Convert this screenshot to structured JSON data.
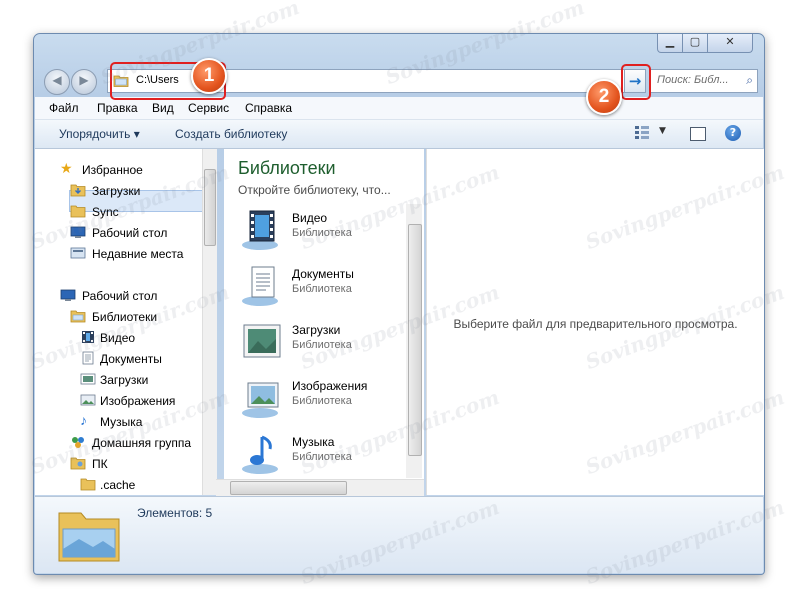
{
  "window": {
    "caption_buttons": {
      "minimize_icon": "minimize-icon",
      "maximize_icon": "maximize-icon",
      "close_icon": "close-icon"
    }
  },
  "navigation": {
    "back_icon": "back-arrow-icon",
    "forward_icon": "forward-arrow-icon"
  },
  "address_bar": {
    "path": "C:\\Users",
    "go_icon": "arrow-right-icon"
  },
  "search": {
    "placeholder": "Поиск: Библ..."
  },
  "annotations": {
    "marker1": "1",
    "marker2": "2",
    "highlight_color": "#e02020"
  },
  "menu": {
    "file": "Файл",
    "edit": "Правка",
    "view": "Вид",
    "service": "Сервис",
    "help": "Справка"
  },
  "toolbar": {
    "organize": "Упорядочить ▾",
    "create_library": "Создать библиотеку",
    "help": "?"
  },
  "nav_pane": {
    "favorites": "Избранное",
    "downloads": "Загрузки",
    "sync": "Sync",
    "desktop": "Рабочий стол",
    "recent": "Недавние места",
    "desktop_root": "Рабочий стол",
    "libraries": "Библиотеки",
    "video": "Видео",
    "documents": "Документы",
    "downloads2": "Загрузки",
    "images": "Изображения",
    "music": "Музыка",
    "homegroup": "Домашняя группа",
    "pc": "ПК",
    "cache": ".cache"
  },
  "libraries_pane": {
    "title": "Библиотеки",
    "subtitle": "Откройте библиотеку, что...",
    "items": [
      {
        "name": "Видео",
        "type": "Библиотека"
      },
      {
        "name": "Документы",
        "type": "Библиотека"
      },
      {
        "name": "Загрузки",
        "type": "Библиотека"
      },
      {
        "name": "Изображения",
        "type": "Библиотека"
      },
      {
        "name": "Музыка",
        "type": "Библиотека"
      }
    ]
  },
  "preview_pane": {
    "message": "Выберите файл для предварительного просмотра."
  },
  "details_pane": {
    "count": "Элементов: 5"
  },
  "watermark": "Sovingperpair.com"
}
